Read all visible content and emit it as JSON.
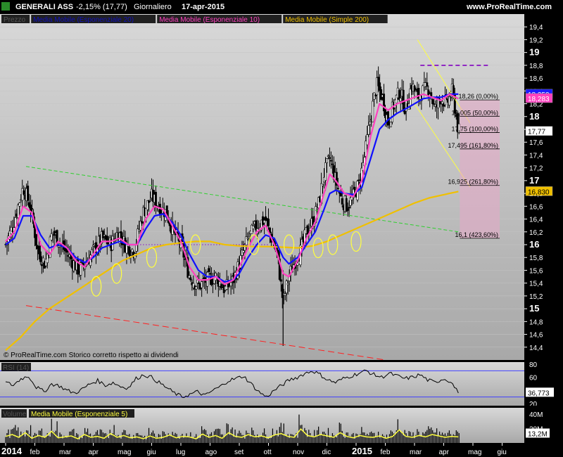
{
  "header": {
    "instrument": "GENERALI ASS",
    "change": "-2,15% (17,77)",
    "period": "Giornaliero",
    "date": "17-apr-2015",
    "site": "www.ProRealTime.com"
  },
  "legend_price": [
    {
      "label": "Prezzo",
      "color": "#000000",
      "bg": "#000000",
      "text_color": "#1a1a1a"
    },
    {
      "label": "Media Mobile (Esponenziale 20)",
      "color": "#1010ff",
      "bg": "#000000",
      "text_color": "#1010c0"
    },
    {
      "label": "Media Mobile (Esponenziale 10)",
      "color": "#ff40c0",
      "bg": "#000000",
      "text_color": "#ff40c0"
    },
    {
      "label": "Media Mobile (Simple 200)",
      "color": "#f0c000",
      "bg": "#000000",
      "text_color": "#f0c000"
    }
  ],
  "copyright": "© ProRealTime.com  Storico corretto rispetto ai dividendi",
  "rsi_label": "RSI (14)",
  "volume_label": "Volume",
  "volume_ma_label": "Media Mobile (Esponenziale 5)",
  "fib_levels": [
    {
      "price": 18.26,
      "label": "18,26  (0,00%)"
    },
    {
      "price": 18.005,
      "label": "18,005  (50,00%)"
    },
    {
      "price": 17.75,
      "label": "17,75  (100,00%)"
    },
    {
      "price": 17.495,
      "label": "17,495  (161,80%)"
    },
    {
      "price": 16.925,
      "label": "16,925  (261,80%)"
    },
    {
      "price": 16.1,
      "label": "16,1  (423,60%)"
    }
  ],
  "price_tags": [
    {
      "value": "18,350",
      "bg": "#1a1aff",
      "fg": "#ffffff"
    },
    {
      "value": "18,283",
      "bg": "#ff40c0",
      "fg": "#ffffff"
    },
    {
      "value": "17,77",
      "bg": "#ffffff",
      "fg": "#000000"
    },
    {
      "value": "16,830",
      "bg": "#f0c000",
      "fg": "#000000"
    }
  ],
  "rsi_tag": "36,773",
  "volume_tag": "13,2M",
  "chart_data": {
    "type": "candlestick",
    "title": "GENERALI ASS",
    "ylim": [
      14.2,
      19.6
    ],
    "y_ticks": [
      "14,4",
      "14,6",
      "14,8",
      "15",
      "15,2",
      "15,4",
      "15,6",
      "15,8",
      "16",
      "16,2",
      "16,4",
      "16,6",
      "16,8",
      "17",
      "17,2",
      "17,4",
      "17,6",
      "17,8",
      "18",
      "18,2",
      "18,4",
      "18,6",
      "18,8",
      "19",
      "19,2",
      "19,4"
    ],
    "y_ticks_bold": [
      "15",
      "16",
      "17",
      "18",
      "19"
    ],
    "x_ticks": [
      "2014",
      "feb",
      "mar",
      "apr",
      "mag",
      "giu",
      "lug",
      "ago",
      "set",
      "ott",
      "nov",
      "dic",
      "2015",
      "feb",
      "mar",
      "apr",
      "mag",
      "giu"
    ],
    "x_ticks_bold": [
      "2014",
      "2015"
    ],
    "close_path": [
      {
        "m": 0,
        "v": 16.0
      },
      {
        "m": 0.25,
        "v": 16.3
      },
      {
        "m": 0.6,
        "v": 16.9
      },
      {
        "m": 0.85,
        "v": 16.6
      },
      {
        "m": 1.1,
        "v": 15.9
      },
      {
        "m": 1.35,
        "v": 15.7
      },
      {
        "m": 1.6,
        "v": 16.2
      },
      {
        "m": 1.9,
        "v": 16.0
      },
      {
        "m": 2.2,
        "v": 15.8
      },
      {
        "m": 2.5,
        "v": 15.6
      },
      {
        "m": 2.8,
        "v": 15.75
      },
      {
        "m": 3.0,
        "v": 15.9
      },
      {
        "m": 3.3,
        "v": 16.1
      },
      {
        "m": 3.6,
        "v": 16.0
      },
      {
        "m": 3.85,
        "v": 16.2
      },
      {
        "m": 4.1,
        "v": 16.0
      },
      {
        "m": 4.4,
        "v": 15.9
      },
      {
        "m": 4.7,
        "v": 16.5
      },
      {
        "m": 5.0,
        "v": 16.75
      },
      {
        "m": 5.25,
        "v": 16.6
      },
      {
        "m": 5.5,
        "v": 16.5
      },
      {
        "m": 5.75,
        "v": 16.2
      },
      {
        "m": 6.0,
        "v": 16.0
      },
      {
        "m": 6.3,
        "v": 15.5
      },
      {
        "m": 6.6,
        "v": 15.35
      },
      {
        "m": 6.9,
        "v": 15.45
      },
      {
        "m": 7.2,
        "v": 15.5
      },
      {
        "m": 7.5,
        "v": 15.3
      },
      {
        "m": 7.8,
        "v": 15.45
      },
      {
        "m": 8.0,
        "v": 15.7
      },
      {
        "m": 8.3,
        "v": 16.1
      },
      {
        "m": 8.6,
        "v": 16.3
      },
      {
        "m": 8.9,
        "v": 16.4
      },
      {
        "m": 9.1,
        "v": 16.1
      },
      {
        "m": 9.3,
        "v": 15.85
      },
      {
        "m": 9.5,
        "v": 15.1
      },
      {
        "m": 9.7,
        "v": 15.5
      },
      {
        "m": 9.9,
        "v": 15.75
      },
      {
        "m": 10.1,
        "v": 15.9
      },
      {
        "m": 10.3,
        "v": 16.2
      },
      {
        "m": 10.5,
        "v": 16.35
      },
      {
        "m": 10.7,
        "v": 16.6
      },
      {
        "m": 10.9,
        "v": 17.1
      },
      {
        "m": 11.1,
        "v": 17.35
      },
      {
        "m": 11.3,
        "v": 17.0
      },
      {
        "m": 11.5,
        "v": 16.7
      },
      {
        "m": 11.7,
        "v": 16.6
      },
      {
        "m": 11.9,
        "v": 16.75
      },
      {
        "m": 12.1,
        "v": 16.95
      },
      {
        "m": 12.3,
        "v": 17.4
      },
      {
        "m": 12.5,
        "v": 18.0
      },
      {
        "m": 12.7,
        "v": 18.5
      },
      {
        "m": 12.9,
        "v": 18.3
      },
      {
        "m": 13.1,
        "v": 17.9
      },
      {
        "m": 13.3,
        "v": 18.2
      },
      {
        "m": 13.5,
        "v": 18.4
      },
      {
        "m": 13.7,
        "v": 18.1
      },
      {
        "m": 13.9,
        "v": 18.5
      },
      {
        "m": 14.1,
        "v": 18.3
      },
      {
        "m": 14.3,
        "v": 18.4
      },
      {
        "m": 14.5,
        "v": 18.45
      },
      {
        "m": 14.7,
        "v": 18.1
      },
      {
        "m": 14.9,
        "v": 18.3
      },
      {
        "m": 15.1,
        "v": 18.2
      },
      {
        "m": 15.3,
        "v": 18.4
      },
      {
        "m": 15.5,
        "v": 17.77
      }
    ],
    "ema10": [
      {
        "m": 0,
        "v": 16.05
      },
      {
        "m": 0.3,
        "v": 16.2
      },
      {
        "m": 0.6,
        "v": 16.6
      },
      {
        "m": 0.9,
        "v": 16.5
      },
      {
        "m": 1.2,
        "v": 16.0
      },
      {
        "m": 1.5,
        "v": 15.85
      },
      {
        "m": 1.8,
        "v": 16.05
      },
      {
        "m": 2.1,
        "v": 15.95
      },
      {
        "m": 2.4,
        "v": 15.75
      },
      {
        "m": 2.7,
        "v": 15.65
      },
      {
        "m": 3.0,
        "v": 15.85
      },
      {
        "m": 3.3,
        "v": 16.05
      },
      {
        "m": 3.6,
        "v": 16.05
      },
      {
        "m": 3.9,
        "v": 16.1
      },
      {
        "m": 4.2,
        "v": 16.0
      },
      {
        "m": 4.5,
        "v": 16.0
      },
      {
        "m": 4.8,
        "v": 16.4
      },
      {
        "m": 5.1,
        "v": 16.6
      },
      {
        "m": 5.4,
        "v": 16.55
      },
      {
        "m": 5.7,
        "v": 16.3
      },
      {
        "m": 6.0,
        "v": 16.05
      },
      {
        "m": 6.3,
        "v": 15.65
      },
      {
        "m": 6.6,
        "v": 15.45
      },
      {
        "m": 6.9,
        "v": 15.45
      },
      {
        "m": 7.2,
        "v": 15.5
      },
      {
        "m": 7.5,
        "v": 15.38
      },
      {
        "m": 7.8,
        "v": 15.45
      },
      {
        "m": 8.0,
        "v": 15.65
      },
      {
        "m": 8.3,
        "v": 15.95
      },
      {
        "m": 8.6,
        "v": 16.2
      },
      {
        "m": 8.9,
        "v": 16.3
      },
      {
        "m": 9.2,
        "v": 16.0
      },
      {
        "m": 9.5,
        "v": 15.55
      },
      {
        "m": 9.7,
        "v": 15.5
      },
      {
        "m": 10.0,
        "v": 15.75
      },
      {
        "m": 10.3,
        "v": 16.1
      },
      {
        "m": 10.6,
        "v": 16.35
      },
      {
        "m": 10.9,
        "v": 16.8
      },
      {
        "m": 11.1,
        "v": 17.1
      },
      {
        "m": 11.3,
        "v": 17.0
      },
      {
        "m": 11.6,
        "v": 16.8
      },
      {
        "m": 11.9,
        "v": 16.75
      },
      {
        "m": 12.2,
        "v": 17.0
      },
      {
        "m": 12.5,
        "v": 17.7
      },
      {
        "m": 12.8,
        "v": 18.2
      },
      {
        "m": 13.1,
        "v": 18.1
      },
      {
        "m": 13.4,
        "v": 18.2
      },
      {
        "m": 13.7,
        "v": 18.25
      },
      {
        "m": 14.0,
        "v": 18.3
      },
      {
        "m": 14.3,
        "v": 18.35
      },
      {
        "m": 14.6,
        "v": 18.3
      },
      {
        "m": 14.9,
        "v": 18.25
      },
      {
        "m": 15.2,
        "v": 18.35
      },
      {
        "m": 15.5,
        "v": 18.28
      }
    ],
    "ema20": [
      {
        "m": 0,
        "v": 16.0
      },
      {
        "m": 0.3,
        "v": 16.1
      },
      {
        "m": 0.6,
        "v": 16.45
      },
      {
        "m": 0.9,
        "v": 16.45
      },
      {
        "m": 1.2,
        "v": 16.15
      },
      {
        "m": 1.5,
        "v": 15.95
      },
      {
        "m": 1.8,
        "v": 16.0
      },
      {
        "m": 2.1,
        "v": 15.95
      },
      {
        "m": 2.4,
        "v": 15.8
      },
      {
        "m": 2.7,
        "v": 15.72
      },
      {
        "m": 3.0,
        "v": 15.8
      },
      {
        "m": 3.3,
        "v": 15.95
      },
      {
        "m": 3.6,
        "v": 16.0
      },
      {
        "m": 3.9,
        "v": 16.05
      },
      {
        "m": 4.2,
        "v": 16.0
      },
      {
        "m": 4.5,
        "v": 16.0
      },
      {
        "m": 4.8,
        "v": 16.25
      },
      {
        "m": 5.1,
        "v": 16.45
      },
      {
        "m": 5.4,
        "v": 16.48
      },
      {
        "m": 5.7,
        "v": 16.35
      },
      {
        "m": 6.0,
        "v": 16.15
      },
      {
        "m": 6.3,
        "v": 15.85
      },
      {
        "m": 6.6,
        "v": 15.6
      },
      {
        "m": 6.9,
        "v": 15.5
      },
      {
        "m": 7.2,
        "v": 15.5
      },
      {
        "m": 7.5,
        "v": 15.42
      },
      {
        "m": 7.8,
        "v": 15.45
      },
      {
        "m": 8.0,
        "v": 15.55
      },
      {
        "m": 8.3,
        "v": 15.8
      },
      {
        "m": 8.6,
        "v": 16.0
      },
      {
        "m": 8.9,
        "v": 16.15
      },
      {
        "m": 9.2,
        "v": 16.1
      },
      {
        "m": 9.5,
        "v": 15.8
      },
      {
        "m": 9.7,
        "v": 15.7
      },
      {
        "m": 10.0,
        "v": 15.8
      },
      {
        "m": 10.3,
        "v": 16.0
      },
      {
        "m": 10.6,
        "v": 16.2
      },
      {
        "m": 10.9,
        "v": 16.55
      },
      {
        "m": 11.1,
        "v": 16.8
      },
      {
        "m": 11.3,
        "v": 16.85
      },
      {
        "m": 11.6,
        "v": 16.8
      },
      {
        "m": 11.9,
        "v": 16.78
      },
      {
        "m": 12.2,
        "v": 16.9
      },
      {
        "m": 12.5,
        "v": 17.35
      },
      {
        "m": 12.8,
        "v": 17.8
      },
      {
        "m": 13.1,
        "v": 17.95
      },
      {
        "m": 13.4,
        "v": 18.05
      },
      {
        "m": 13.7,
        "v": 18.12
      },
      {
        "m": 14.0,
        "v": 18.2
      },
      {
        "m": 14.3,
        "v": 18.28
      },
      {
        "m": 14.6,
        "v": 18.3
      },
      {
        "m": 14.9,
        "v": 18.3
      },
      {
        "m": 15.2,
        "v": 18.35
      },
      {
        "m": 15.5,
        "v": 18.35
      }
    ],
    "sma200": [
      {
        "m": 0,
        "v": 14.35
      },
      {
        "m": 0.5,
        "v": 14.55
      },
      {
        "m": 1.0,
        "v": 14.8
      },
      {
        "m": 1.5,
        "v": 15.0
      },
      {
        "m": 2.0,
        "v": 15.15
      },
      {
        "m": 2.5,
        "v": 15.3
      },
      {
        "m": 3.0,
        "v": 15.45
      },
      {
        "m": 3.5,
        "v": 15.6
      },
      {
        "m": 4.0,
        "v": 15.75
      },
      {
        "m": 4.5,
        "v": 15.85
      },
      {
        "m": 5.0,
        "v": 15.95
      },
      {
        "m": 5.5,
        "v": 16.0
      },
      {
        "m": 6.0,
        "v": 16.03
      },
      {
        "m": 6.5,
        "v": 16.05
      },
      {
        "m": 7.0,
        "v": 16.05
      },
      {
        "m": 7.5,
        "v": 16.0
      },
      {
        "m": 8.0,
        "v": 15.98
      },
      {
        "m": 8.5,
        "v": 15.97
      },
      {
        "m": 9.0,
        "v": 15.97
      },
      {
        "m": 9.5,
        "v": 15.96
      },
      {
        "m": 10.0,
        "v": 15.95
      },
      {
        "m": 10.5,
        "v": 15.98
      },
      {
        "m": 11.0,
        "v": 16.05
      },
      {
        "m": 11.5,
        "v": 16.15
      },
      {
        "m": 12.0,
        "v": 16.25
      },
      {
        "m": 12.5,
        "v": 16.35
      },
      {
        "m": 13.0,
        "v": 16.45
      },
      {
        "m": 13.5,
        "v": 16.55
      },
      {
        "m": 14.0,
        "v": 16.65
      },
      {
        "m": 14.5,
        "v": 16.73
      },
      {
        "m": 15.0,
        "v": 16.78
      },
      {
        "m": 15.5,
        "v": 16.83
      }
    ],
    "green_line": [
      {
        "m": 0.7,
        "v": 17.22
      },
      {
        "m": 15.5,
        "v": 16.2
      }
    ],
    "red_line": [
      {
        "m": 0.7,
        "v": 15.05
      },
      {
        "m": 13.0,
        "v": 14.2
      }
    ],
    "yellow_channel_upper": [
      {
        "m": 14.1,
        "v": 19.2
      },
      {
        "m": 15.9,
        "v": 17.9
      }
    ],
    "yellow_channel_lower": [
      {
        "m": 14.0,
        "v": 18.2
      },
      {
        "m": 15.9,
        "v": 16.9
      }
    ],
    "resistance_dashed": {
      "from": 14.2,
      "to": 16.6,
      "v": 18.8
    },
    "support_dotted": {
      "from": 4.6,
      "to": 9.0,
      "v": 16.0
    },
    "circles": [
      {
        "m": 3.1,
        "v": 15.35
      },
      {
        "m": 3.8,
        "v": 15.55
      },
      {
        "m": 5.0,
        "v": 15.8
      },
      {
        "m": 6.5,
        "v": 16.0
      },
      {
        "m": 8.5,
        "v": 16.0
      },
      {
        "m": 9.7,
        "v": 16.0
      },
      {
        "m": 10.7,
        "v": 15.95
      },
      {
        "m": 11.2,
        "v": 16.0
      },
      {
        "m": 12.0,
        "v": 16.05
      }
    ],
    "rsi": {
      "ylim": [
        20,
        80
      ],
      "ticks": [
        "20",
        "40",
        "60",
        "80"
      ],
      "bands": [
        30,
        70
      ],
      "values": [
        52,
        48,
        58,
        62,
        45,
        38,
        50,
        47,
        40,
        36,
        42,
        50,
        55,
        48,
        52,
        46,
        44,
        58,
        64,
        60,
        52,
        44,
        36,
        30,
        34,
        38,
        32,
        40,
        46,
        55,
        58,
        62,
        50,
        38,
        30,
        40,
        48,
        56,
        60,
        66,
        70,
        64,
        56,
        52,
        58,
        62,
        66,
        70,
        64,
        60,
        66,
        62,
        58,
        60,
        64,
        56,
        52,
        58,
        54,
        36
      ]
    },
    "volume": {
      "ticks": [
        "20M",
        "40M"
      ],
      "values": [
        14,
        18,
        12,
        22,
        10,
        16,
        12,
        25,
        11,
        13,
        15,
        9,
        18,
        12,
        14,
        10,
        20,
        12,
        16,
        11,
        13,
        9,
        15,
        10,
        12,
        17,
        11,
        14,
        13,
        9,
        19,
        12,
        16,
        10,
        22,
        14,
        12,
        18,
        13,
        15,
        11,
        17,
        20,
        14,
        12,
        30,
        16,
        13,
        18,
        15,
        12,
        22,
        14,
        11,
        16,
        13,
        12,
        15,
        10,
        14,
        28,
        14,
        12,
        16,
        13,
        18,
        15,
        12,
        14,
        13
      ]
    }
  }
}
